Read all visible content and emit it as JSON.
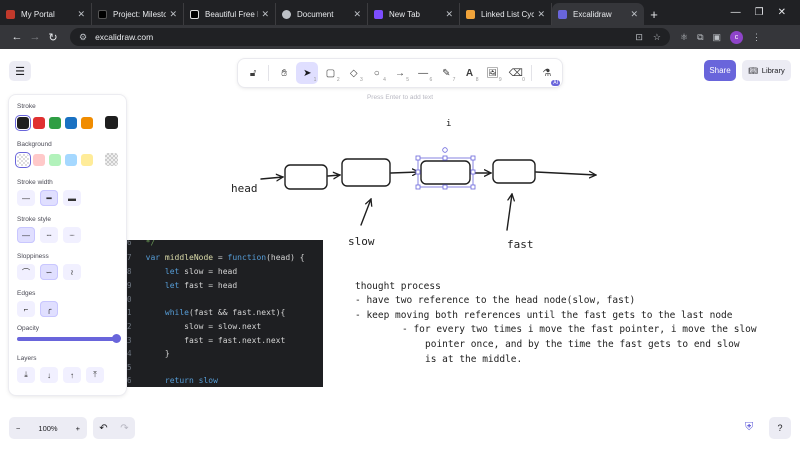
{
  "browser": {
    "tabs": [
      {
        "title": "My Portal",
        "favicon_color": "#c0392b"
      },
      {
        "title": "Project: Milestone",
        "favicon_color": "#000000"
      },
      {
        "title": "Beautiful Free Im",
        "favicon_color": "#000000"
      },
      {
        "title": "Document",
        "favicon_color": "#bdc1c6"
      },
      {
        "title": "New Tab",
        "favicon_color": "#7c4dff"
      },
      {
        "title": "Linked List Cycle",
        "favicon_color": "#f0a33a"
      },
      {
        "title": "Excalidraw",
        "favicon_color": "#6965db"
      }
    ],
    "url": "excalidraw.com",
    "profile_initial": "c"
  },
  "app": {
    "share_label": "Share",
    "library_label": "Library",
    "hint": "Press Enter to add text",
    "tool_ai_badge": "AI",
    "tools": [
      {
        "icon": "lock-icon",
        "num": ""
      },
      {
        "icon": "hand-icon",
        "num": ""
      },
      {
        "icon": "selection-icon",
        "num": "1"
      },
      {
        "icon": "rectangle-icon",
        "num": "2"
      },
      {
        "icon": "diamond-icon",
        "num": "3"
      },
      {
        "icon": "ellipse-icon",
        "num": "4"
      },
      {
        "icon": "arrow-icon",
        "num": "5"
      },
      {
        "icon": "line-icon",
        "num": "6"
      },
      {
        "icon": "pencil-icon",
        "num": "7"
      },
      {
        "icon": "text-icon",
        "num": "8"
      },
      {
        "icon": "image-icon",
        "num": "9"
      },
      {
        "icon": "eraser-icon",
        "num": "0"
      },
      {
        "icon": "extra-tools-icon",
        "num": ""
      }
    ]
  },
  "panel": {
    "stroke_label": "Stroke",
    "stroke_colors": [
      "#1e1e1e",
      "#e03131",
      "#2f9e44",
      "#1971c2",
      "#f08c00",
      "#1e1e1e"
    ],
    "background_label": "Background",
    "background_colors": [
      "#ffffff",
      "#ffc9c9",
      "#b2f2bb",
      "#a5d8ff",
      "#ffec99"
    ],
    "stroke_width_label": "Stroke width",
    "stroke_style_label": "Stroke style",
    "sloppiness_label": "Sloppiness",
    "edges_label": "Edges",
    "opacity_label": "Opacity",
    "opacity_value": 100,
    "layers_label": "Layers"
  },
  "zoom": {
    "minus": "−",
    "value": "100%",
    "plus": "+"
  },
  "drawing": {
    "select_marker": "i",
    "head": "head",
    "slow": "slow",
    "fast": "fast",
    "notes": [
      "thought process",
      "- have two reference to the head node(slow, fast)",
      "- keep moving both references until the fast gets to the last node",
      "- for every two times i move the fast pointer, i move the slow",
      "pointer once, and by the time the fast gets to end slow",
      "is at the middle."
    ]
  },
  "code": {
    "lines": [
      {
        "num": "6",
        "text": "*/"
      },
      {
        "num": "7",
        "text": "var middleNode = function(head) {"
      },
      {
        "num": "8",
        "text": "    let slow = head"
      },
      {
        "num": "9",
        "text": "    let fast = head"
      },
      {
        "num": "0",
        "text": ""
      },
      {
        "num": "1",
        "text": "    while(fast && fast.next){"
      },
      {
        "num": "2",
        "text": "        slow = slow.next"
      },
      {
        "num": "3",
        "text": "        fast = fast.next.next"
      },
      {
        "num": "4",
        "text": "    }"
      },
      {
        "num": "5",
        "text": ""
      },
      {
        "num": "6",
        "text": "    return slow"
      }
    ]
  }
}
